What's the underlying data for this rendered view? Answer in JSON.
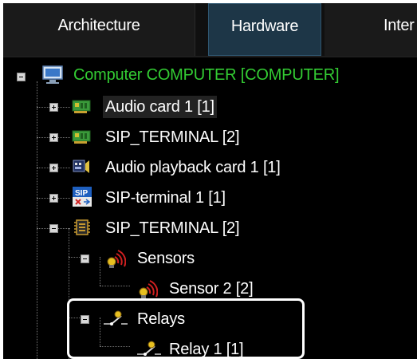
{
  "tabs": [
    {
      "label": "Architecture"
    },
    {
      "label": "Hardware",
      "active": true
    },
    {
      "label": "Inter"
    }
  ],
  "tree": {
    "root": {
      "label": "Computer COMPUTER [COMPUTER]",
      "color": "#33cc33"
    },
    "items": [
      {
        "label": "Audio card 1 [1]",
        "icon": "audio-card-icon",
        "expander": "plus"
      },
      {
        "label": "SIP_TERMINAL [2]",
        "icon": "sip-terminal-board-icon",
        "expander": "plus"
      },
      {
        "label": "Audio playback card 1 [1]",
        "icon": "audio-playback-card-icon",
        "expander": "plus"
      },
      {
        "label": "SIP-terminal 1 [1]",
        "icon": "sip-terminal-icon",
        "expander": "plus"
      },
      {
        "label": "SIP_TERMINAL [2]",
        "icon": "chip-icon",
        "expander": "minus"
      },
      {
        "label": "Sensors",
        "icon": "sensor-icon",
        "expander": "minus"
      },
      {
        "label": "Sensor 2 [2]",
        "icon": "sensor-icon"
      },
      {
        "label": "Relays",
        "icon": "relay-icon",
        "expander": "minus"
      },
      {
        "label": "Relay 1 [1]",
        "icon": "relay-icon"
      }
    ]
  },
  "colors": {
    "active_tab": "#1d3647",
    "root_text": "#33cc33",
    "highlight": "#ffffff"
  }
}
